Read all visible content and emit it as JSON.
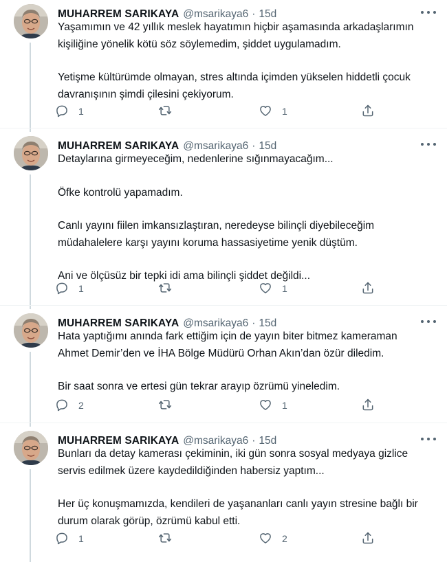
{
  "tweets": [
    {
      "name": "MUHARREM SARIKAYA",
      "handle": "@msarikaya6",
      "dot": "·",
      "time": "15d",
      "paragraphs": [
        [
          "Yaşamımın ve 42 yıllık meslek hayatımın hiçbir aşamasında arkadaşlarımın",
          "kişiliğine yönelik kötü söz söylemedim, şiddet uygulamadım."
        ],
        [
          "Yetişme kültürümde olmayan, stres altında içimden yükselen hiddetli çocuk",
          "davranışının şimdi çilesini çekiyorum."
        ]
      ],
      "reply_count": "1",
      "retweet_count": "",
      "like_count": "1"
    },
    {
      "name": "MUHARREM SARIKAYA",
      "handle": "@msarikaya6",
      "dot": "·",
      "time": "15d",
      "paragraphs": [
        [
          "Detaylarına girmeyeceğim, nedenlerine sığınmayacağım..."
        ],
        [
          "Öfke kontrolü yapamadım."
        ],
        [
          "Canlı yayını fiilen imkansızlaştıran, neredeyse bilinçli diyebileceğim",
          "müdahalelere karşı yayını koruma hassasiyetime yenik düştüm."
        ],
        [
          "Ani ve ölçüsüz bir tepki idi ama bilinçli şiddet değildi..."
        ]
      ],
      "reply_count": "1",
      "retweet_count": "",
      "like_count": "1"
    },
    {
      "name": "MUHARREM SARIKAYA",
      "handle": "@msarikaya6",
      "dot": "·",
      "time": "15d",
      "paragraphs": [
        [
          "Hata yaptığımı anında fark ettiğim için de yayın biter bitmez kameraman",
          "Ahmet Demir’den ve İHA Bölge Müdürü Orhan Akın’dan özür diledim."
        ],
        [
          "Bir saat sonra ve ertesi gün tekrar arayıp özrümü yineledim."
        ]
      ],
      "reply_count": "2",
      "retweet_count": "",
      "like_count": "1"
    },
    {
      "name": "MUHARREM SARIKAYA",
      "handle": "@msarikaya6",
      "dot": "·",
      "time": "15d",
      "paragraphs": [
        [
          "Bunları da detay kamerası çekiminin, iki gün sonra sosyal medyaya gizlice",
          "servis edilmek üzere kaydedildiğinden habersiz yaptım..."
        ],
        [
          "Her üç konuşmamızda, kendileri de yaşananları canlı yayın stresine bağlı bir",
          "durum olarak görüp, özrümü kabul etti."
        ]
      ],
      "reply_count": "1",
      "retweet_count": "",
      "like_count": "2"
    }
  ],
  "icons": {
    "reply": "reply-icon",
    "retweet": "retweet-icon",
    "like": "heart-icon",
    "share": "share-icon",
    "more": "more-icon"
  },
  "colors": {
    "text": "#0f1419",
    "secondary": "#536471",
    "thread_line": "#cfd9de",
    "divider": "#eff3f4"
  }
}
